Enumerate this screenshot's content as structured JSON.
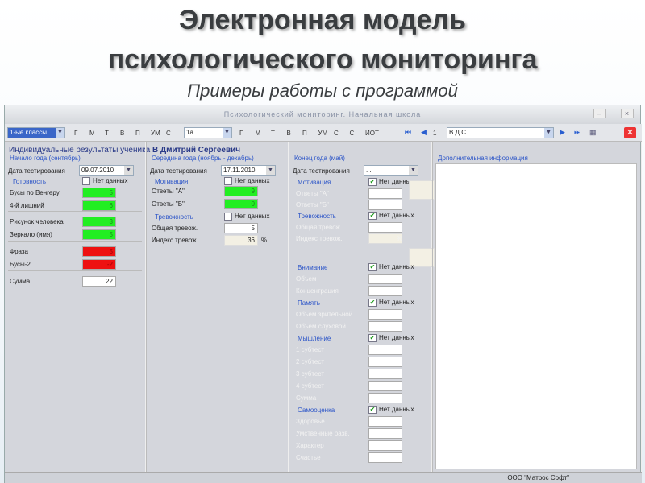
{
  "slide": {
    "title1": "Электронная модель",
    "title2": "психологического мониторинга",
    "subtitle": "Примеры работы с программой"
  },
  "window": {
    "title": "Психологический мониторинг. Начальная школа",
    "minimize": "–",
    "close": "×",
    "status": "ООО \"Матрос Софт\""
  },
  "toolbar": {
    "class_group": "1-ые классы",
    "group_tabs": [
      "Г",
      "М",
      "Т",
      "В",
      "П",
      "УМ",
      "С"
    ],
    "class": "1а",
    "class_tabs": [
      "Г",
      "М",
      "Т",
      "В",
      "П",
      "УМ",
      "С",
      "С",
      "ИОТ"
    ],
    "record_no": "1",
    "student": "В Д.С."
  },
  "header": {
    "prefix": "Индивидуальные результаты ученика",
    "student_name": "В Дмитрий Сергеевич"
  },
  "col1": {
    "title": "Начало года (сентябрь)",
    "date_label": "Дата тестирования",
    "date": "09.07.2010",
    "section": "Готовность",
    "no_data": "Нет данных",
    "rows": [
      {
        "label": "Бусы по Венгеру",
        "value": "5",
        "color": "green"
      },
      {
        "label": "4-й лишний",
        "value": "6",
        "color": "green"
      },
      {
        "label": "Рисунок человека",
        "value": "3",
        "color": "green"
      },
      {
        "label": "Зеркало (имя)",
        "value": "5",
        "color": "green"
      },
      {
        "label": "Фраза",
        "value": "5",
        "color": "red"
      },
      {
        "label": "Бусы-2",
        "value": "-2",
        "color": "red"
      },
      {
        "label": "Сумма",
        "value": "22",
        "color": "white"
      }
    ]
  },
  "col2": {
    "title": "Середина года (ноябрь - декабрь)",
    "date_label": "Дата тестирования",
    "date": "17.11.2010",
    "motivation": "Мотивация",
    "anxiety": "Тревожность",
    "no_data": "Нет данных",
    "motivation_rows": [
      {
        "label": "Ответы \"А\"",
        "value": "9"
      },
      {
        "label": "Ответы \"Б\"",
        "value": "0"
      }
    ],
    "anxiety_rows": [
      {
        "label": "Общая тревож.",
        "value": "5"
      },
      {
        "label": "Индекс тревож.",
        "value": "36"
      }
    ],
    "percent": "%"
  },
  "col3": {
    "title": "Конец года (май)",
    "date_label": "Дата тестирования",
    "date": ". .",
    "no_data": "Нет данных",
    "percent": "%",
    "sections": [
      {
        "name": "Мотивация",
        "rows": [
          "Ответы \"А\"",
          "Ответы \"Б\""
        ]
      },
      {
        "name": "Тревожность",
        "rows": [
          "Общая тревож.",
          "Индекс тревож."
        ]
      },
      {
        "name": "Внимание",
        "rows": [
          "Объем",
          "Концентрация"
        ]
      },
      {
        "name": "Память",
        "rows": [
          "Объем зрительной",
          "Объем слуховой"
        ]
      },
      {
        "name": "Мышление",
        "rows": [
          "1 субтест",
          "2 субтест",
          "3 субтест",
          "4 субтест",
          "Сумма"
        ]
      },
      {
        "name": "Самооценка",
        "rows": [
          "Здоровье",
          "Умственные разв.",
          "Характер",
          "Счастье"
        ]
      }
    ]
  },
  "col4": {
    "title": "Дополнительная информация",
    "notes": ""
  }
}
